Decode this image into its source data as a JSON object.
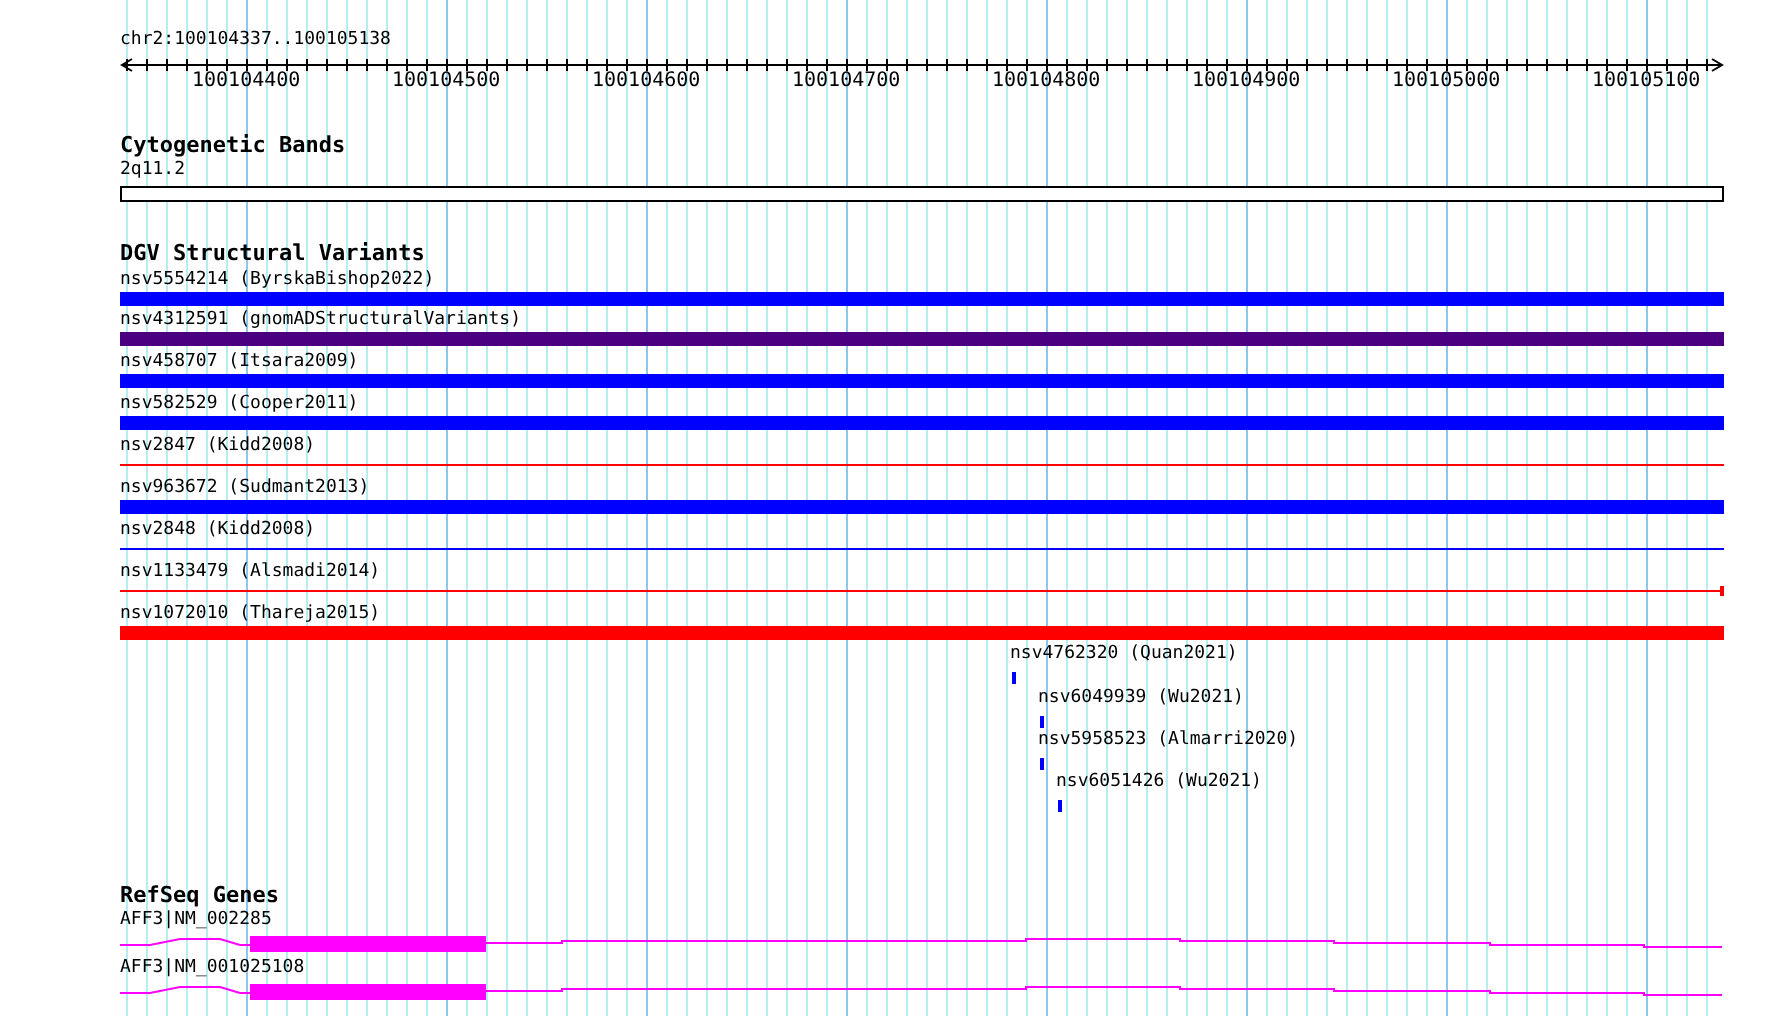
{
  "ruler": {
    "location": "chr2:100104337..100105138",
    "ticks": [
      "100104400",
      "100104500",
      "100104600",
      "100104700",
      "100104800",
      "100104900",
      "100105000",
      "100105100"
    ]
  },
  "tracks": [
    {
      "title": "Cytogenetic Bands",
      "features": [
        {
          "label": "2q11.2",
          "kind": "band"
        }
      ]
    },
    {
      "title": "DGV Structural Variants",
      "features": [
        {
          "label": "nsv5554214 (ByrskaBishop2022)",
          "kind": "thick",
          "color": "#0000ff"
        },
        {
          "label": "nsv4312591 (gnomADStructuralVariants)",
          "kind": "thick",
          "color": "#4b0082"
        },
        {
          "label": "nsv458707 (Itsara2009)",
          "kind": "thick",
          "color": "#0000ff"
        },
        {
          "label": "nsv582529 (Cooper2011)",
          "kind": "thick",
          "color": "#0000ff"
        },
        {
          "label": "nsv2847 (Kidd2008)",
          "kind": "thin",
          "color": "#ff0000"
        },
        {
          "label": "nsv963672 (Sudmant2013)",
          "kind": "thick",
          "color": "#0000ff"
        },
        {
          "label": "nsv2848 (Kidd2008)",
          "kind": "thin",
          "color": "#0000ff"
        },
        {
          "label": "nsv1133479 (Alsmadi2014)",
          "kind": "capped",
          "color": "#ff0000"
        },
        {
          "label": "nsv1072010 (Thareja2015)",
          "kind": "thick",
          "color": "#ff0000"
        },
        {
          "label": "nsv4762320 (Quan2021)",
          "kind": "short",
          "color": "#0000ff"
        },
        {
          "label": "nsv6049939 (Wu2021)",
          "kind": "short",
          "color": "#0000ff"
        },
        {
          "label": "nsv5958523 (Almarri2020)",
          "kind": "short",
          "color": "#0000ff"
        },
        {
          "label": "nsv6051426 (Wu2021)",
          "kind": "short",
          "color": "#0000ff"
        }
      ]
    },
    {
      "title": "RefSeq Genes",
      "features": [
        {
          "label": "AFF3|NM_002285",
          "kind": "gene"
        },
        {
          "label": "AFF3|NM_001025108",
          "kind": "gene"
        }
      ]
    }
  ]
}
